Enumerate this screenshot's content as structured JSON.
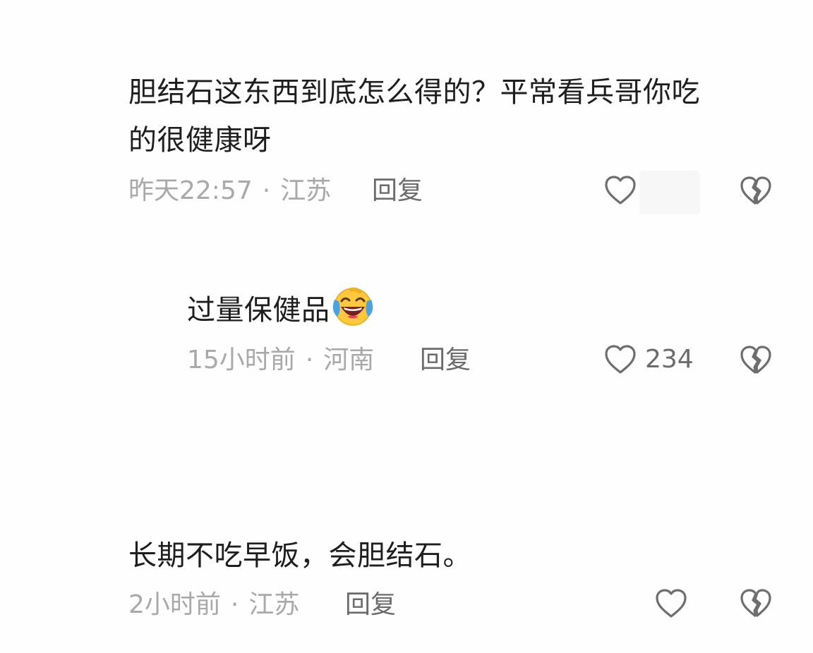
{
  "comments": [
    {
      "text_line1": "胆结石这东西到底怎么得的？平常看兵哥你吃",
      "text_line2": "的很健康呀",
      "time": "昨天22:57",
      "location": "江苏",
      "reply_label": "回复",
      "like_count": ""
    },
    {
      "text": "过量保健品",
      "emoji": "crying-laughing-emoji",
      "time": "15小时前",
      "location": "河南",
      "reply_label": "回复",
      "like_count": "234"
    },
    {
      "text": "长期不吃早饭，会胆结石。",
      "time": "2小时前",
      "location": "江苏",
      "reply_label": "回复",
      "like_count": ""
    }
  ],
  "separator": "·",
  "icons": {
    "like": "heart-outline-icon",
    "dislike": "broken-heart-icon"
  },
  "colors": {
    "text": "#1e1e1e",
    "meta": "#a9a9a9",
    "reply": "#6b6b6b",
    "icon": "#6e6e6e"
  }
}
